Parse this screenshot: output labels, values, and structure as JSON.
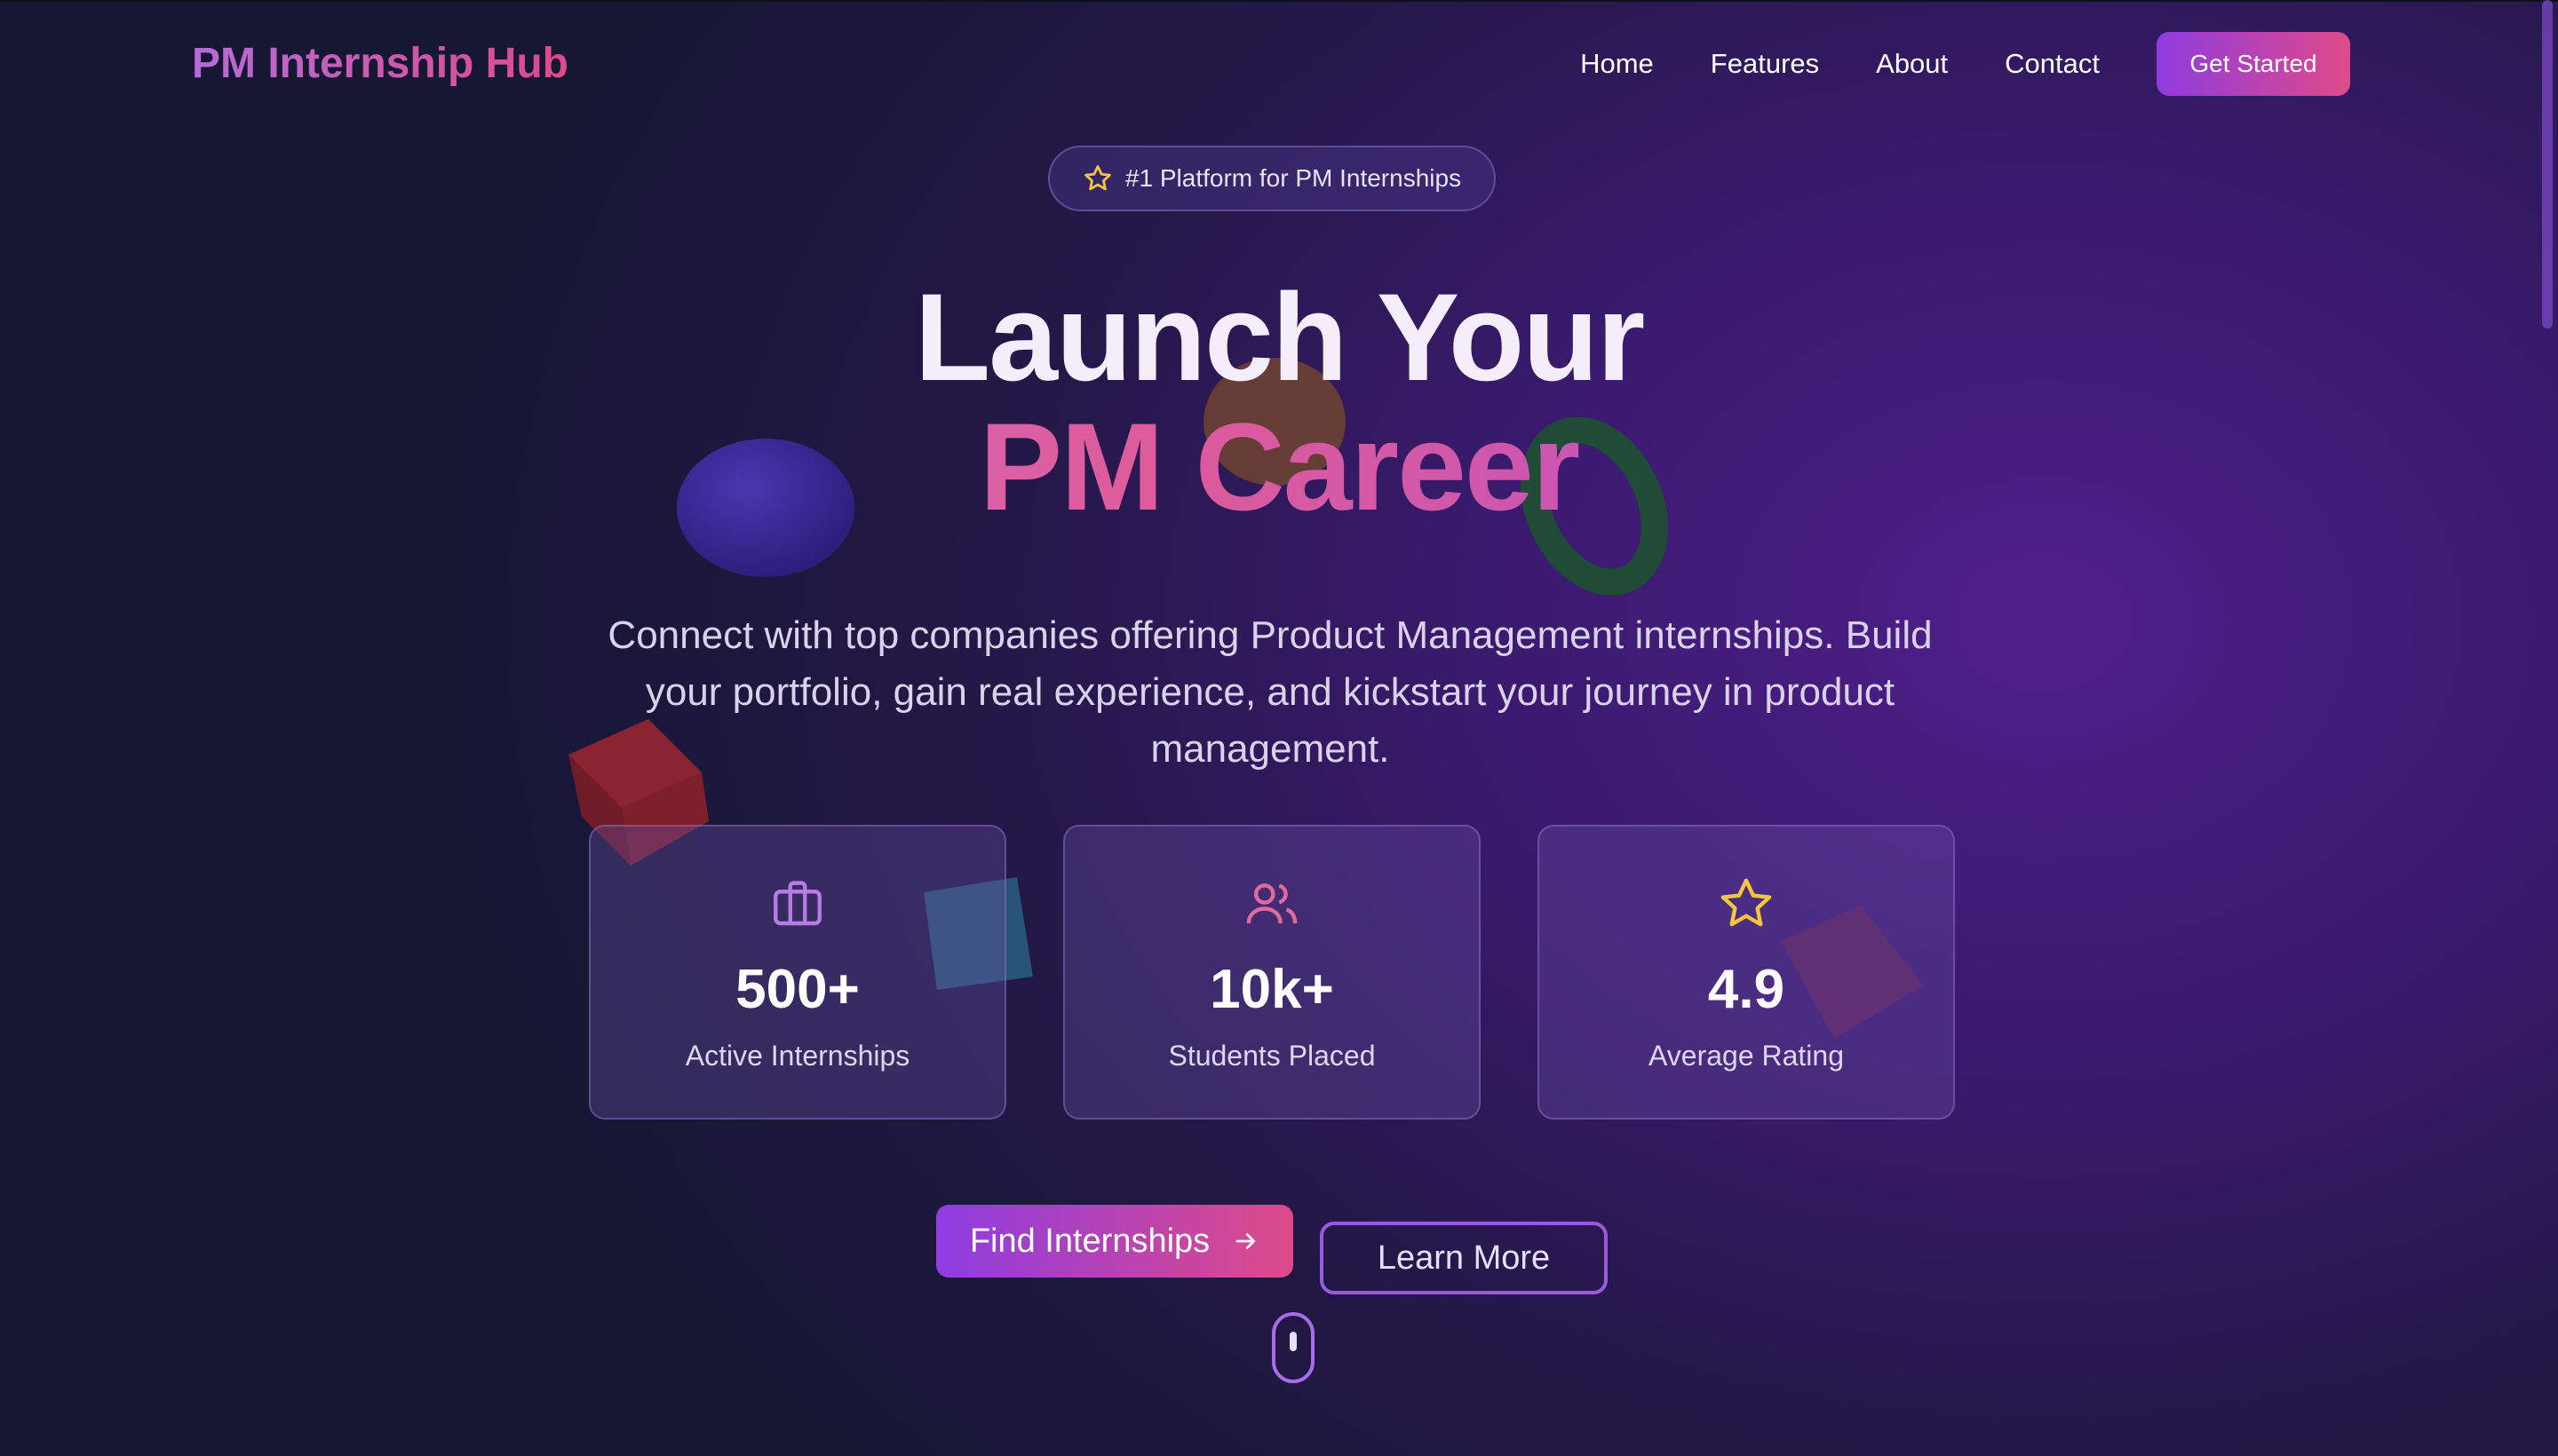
{
  "header": {
    "logo": "PM Internship Hub",
    "nav": [
      {
        "label": "Home"
      },
      {
        "label": "Features"
      },
      {
        "label": "About"
      },
      {
        "label": "Contact"
      }
    ],
    "cta_label": "Get Started"
  },
  "hero": {
    "badge": "#1 Platform for PM Internships",
    "headline_line1": "Launch Your",
    "headline_line2": "PM Career",
    "subtitle": "Connect with top companies offering Product Management internships. Build your portfolio, gain real experience, and kickstart your journey in product management."
  },
  "stats": [
    {
      "icon": "briefcase-icon",
      "value": "500+",
      "label": "Active Internships"
    },
    {
      "icon": "users-icon",
      "value": "10k+",
      "label": "Students Placed"
    },
    {
      "icon": "star-icon",
      "value": "4.9",
      "label": "Average Rating"
    }
  ],
  "actions": {
    "primary": "Find Internships",
    "secondary": "Learn More"
  },
  "colors": {
    "accent_purple": "#8f3be0",
    "accent_pink": "#df4a8a",
    "star_yellow": "#f3c63d"
  }
}
